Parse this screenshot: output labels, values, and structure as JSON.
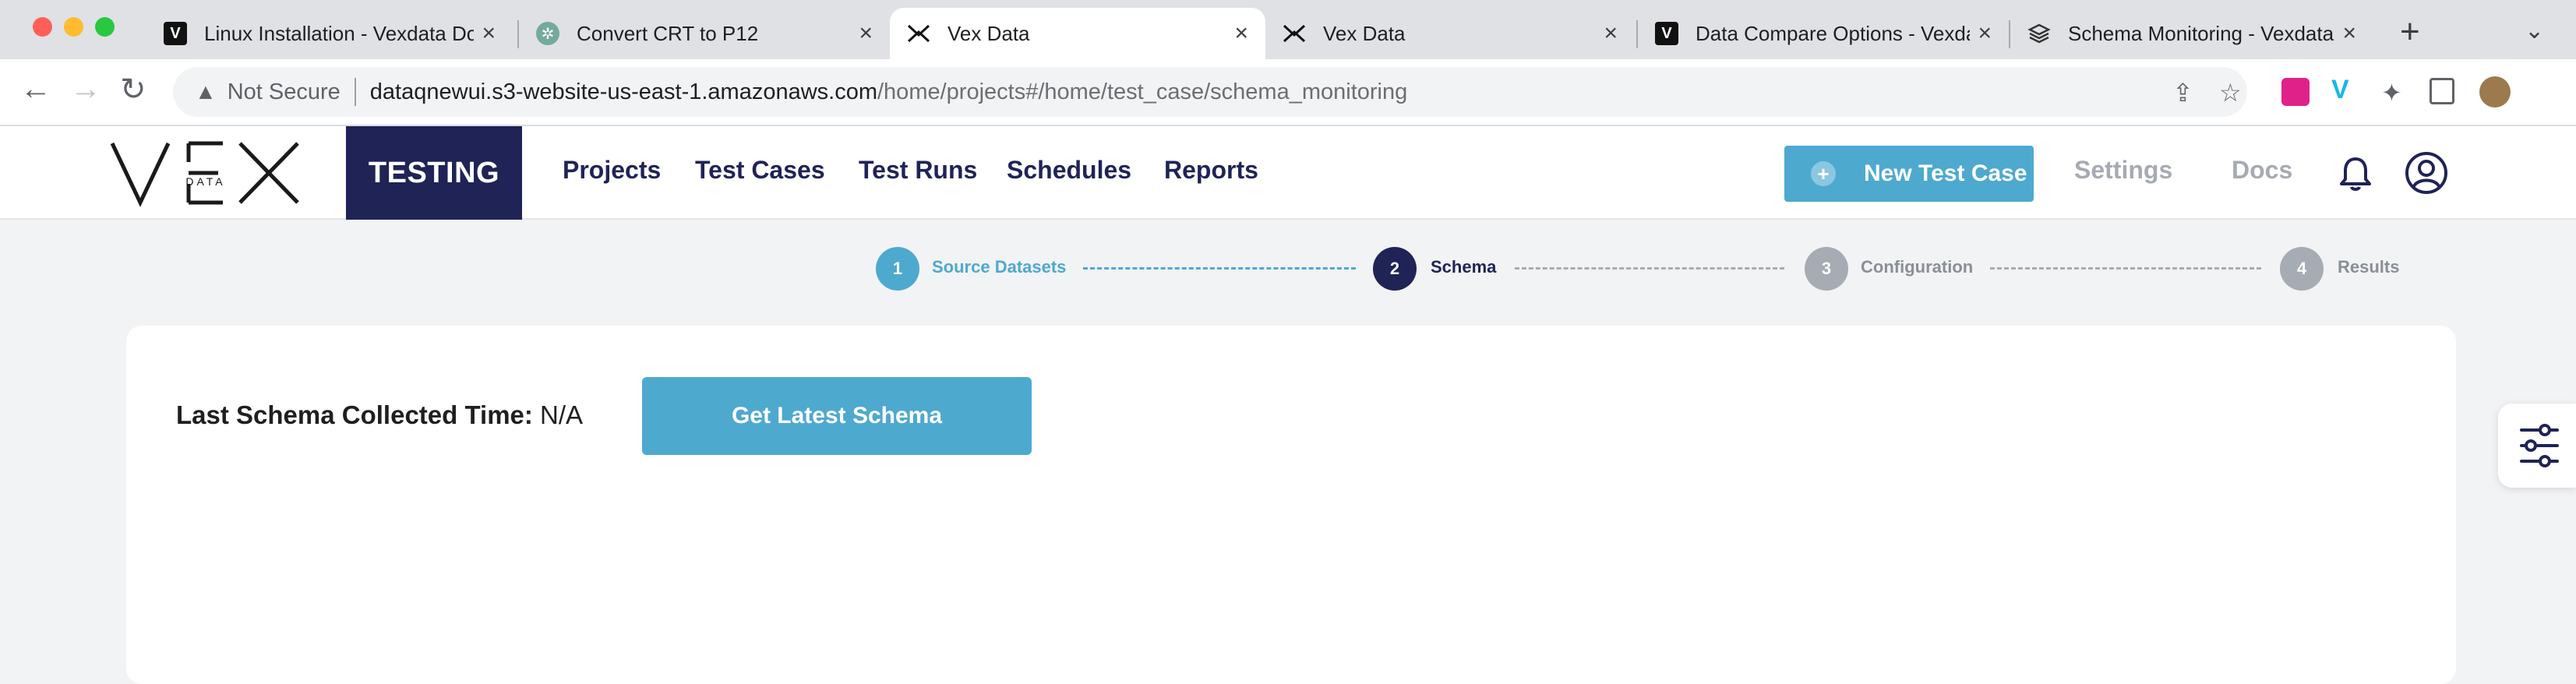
{
  "browser": {
    "tabs": [
      {
        "title": "Linux Installation - Vexdata Docs",
        "favicon": "vexdata-v-icon",
        "active": false
      },
      {
        "title": "Convert CRT to P12",
        "favicon": "chatgpt-icon",
        "active": false
      },
      {
        "title": "Vex Data",
        "favicon": "vex-data-icon",
        "active": true
      },
      {
        "title": "Vex Data",
        "favicon": "vex-data-icon",
        "active": false
      },
      {
        "title": "Data Compare Options - Vexdata Docs",
        "favicon": "vexdata-v-icon",
        "active": false
      },
      {
        "title": "Schema Monitoring - Vexdata Docs",
        "favicon": "gitbook-icon",
        "active": false
      }
    ],
    "new_tab": "+",
    "security_label": "Not Secure",
    "url_host": "dataqnewui.s3-website-us-east-1.amazonaws.com",
    "url_path": "/home/projects#/home/test_case/schema_monitoring"
  },
  "header": {
    "logo_text": "VEX",
    "logo_sub": "DATA",
    "module": "TESTING",
    "nav": [
      "Projects",
      "Test Cases",
      "Test Runs",
      "Schedules",
      "Reports"
    ],
    "new_test_case": "New Test Case",
    "settings": "Settings",
    "docs": "Docs"
  },
  "stepper": {
    "steps": [
      {
        "number": "1",
        "label": "Source Datasets",
        "state": "completed"
      },
      {
        "number": "2",
        "label": "Schema",
        "state": "current"
      },
      {
        "number": "3",
        "label": "Configuration",
        "state": "upcoming"
      },
      {
        "number": "4",
        "label": "Results",
        "state": "upcoming"
      }
    ],
    "colors": {
      "completed": "#4ea9cf",
      "current": "#1f2356",
      "upcoming": "#a6acb3"
    }
  },
  "schema": {
    "collected_label": "Last Schema Collected Time:",
    "collected_value": "N/A",
    "get_latest": "Get Latest Schema"
  },
  "colors": {
    "primary": "#4ea9cf",
    "navy": "#1f2356",
    "muted": "#a6aab2",
    "background": "#f2f3f5"
  }
}
